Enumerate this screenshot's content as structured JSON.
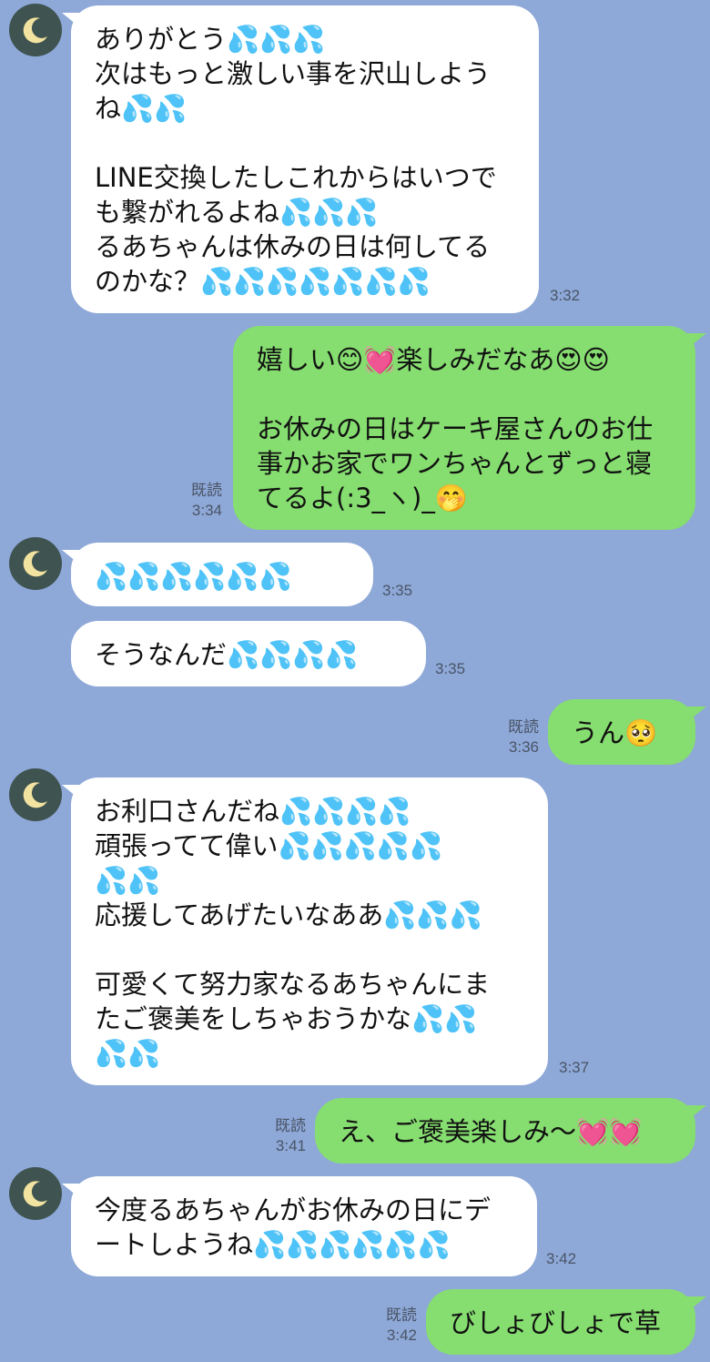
{
  "read_label": "既読",
  "avatar_icon": "crescent-moon-icon",
  "colors": {
    "background": "#8ea8d8",
    "incoming_bubble": "#ffffff",
    "outgoing_bubble": "#86dd70"
  },
  "messages": [
    {
      "text": "ありがとう💦💦💦\n次はもっと激しい事を沢山しよう\nね💦💦\n\nLINE交換したしこれからはいつで\nも繋がれるよね💦💦💦\nるあちゃんは休みの日は何してる\nのかな？💦💦💦💦💦💦💦",
      "time": "3:32"
    },
    {
      "text": "嬉しい😊💓楽しみだなあ😍😍\n\nお休みの日はケーキ屋さんのお仕\n事かお家でワンちゃんとずっと寝\nてるよ(:3_ヽ)_🤭",
      "time": "3:34"
    },
    {
      "text": "💦💦💦💦💦💦",
      "time": "3:35"
    },
    {
      "text": "そうなんだ💦💦💦💦",
      "time": "3:35"
    },
    {
      "text": "うん🥺",
      "time": "3:36"
    },
    {
      "text": "お利口さんだね💦💦💦💦\n頑張ってて偉い💦💦💦💦💦\n💦💦\n応援してあげたいなああ💦💦💦\n\n可愛くて努力家なるあちゃんにま\nたご褒美をしちゃおうかな💦💦\n💦💦",
      "time": "3:37"
    },
    {
      "text": "え、ご褒美楽しみ〜💓💓",
      "time": "3:41"
    },
    {
      "text": "今度るあちゃんがお休みの日にデ\nートしようね💦💦💦💦💦💦",
      "time": "3:42"
    },
    {
      "text": "びしょびしょで草",
      "time": "3:42"
    }
  ]
}
